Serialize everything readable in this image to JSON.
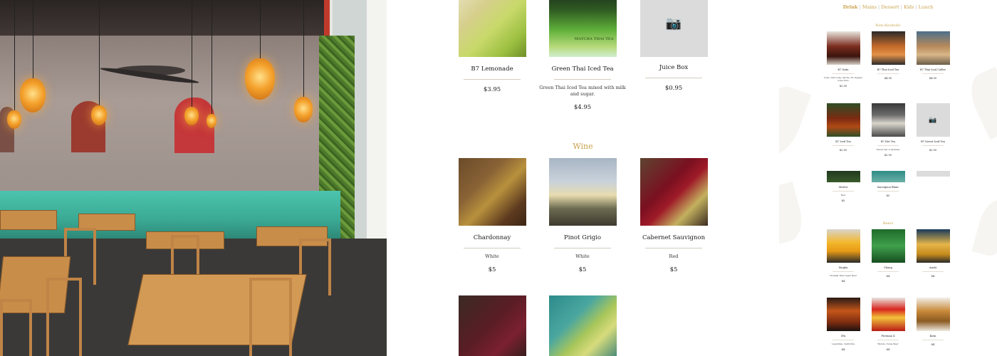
{
  "nav": {
    "items": [
      "Drink",
      "Mains",
      "Dessert",
      "Kids",
      "Lunch"
    ],
    "separator": "|"
  },
  "center": {
    "drinks": [
      {
        "name": "B7 Lemonade",
        "desc": "",
        "price": "$3.95"
      },
      {
        "name": "Green Thai Iced Tea",
        "desc": "Green Thai Iced Tea mixed with milk and sugar.",
        "price": "$4.95",
        "image_text": "MATCHA THAI TEA"
      },
      {
        "name": "Juice Box",
        "desc": "",
        "price": "$0.95"
      }
    ],
    "wine_title": "Wine",
    "wines": [
      {
        "name": "Chardonnay",
        "desc": "White",
        "price": "$5"
      },
      {
        "name": "Pinot Grigio",
        "desc": "White",
        "price": "$5"
      },
      {
        "name": "Cabernet Sauvignon",
        "desc": "Red",
        "price": "$5"
      }
    ]
  },
  "right": {
    "non_alcoholic_title": "Non-Alcoholic",
    "row1": [
      {
        "name": "B7 Soda",
        "desc": "Coke, Diet Coke, Sprite, Dr. Pepper, Coke Zero",
        "price": "$2.95"
      },
      {
        "name": "B7 Thai Iced Tea",
        "desc": "",
        "price": "$4.95"
      },
      {
        "name": "B7 Thai Iced Coffee",
        "desc": "",
        "price": "$4.95"
      }
    ],
    "row2": [
      {
        "name": "B7 Iced Tea",
        "desc": "",
        "price": "$2.95"
      },
      {
        "name": "B7 Hot Tea",
        "desc": "Green Tea or Jasmine",
        "price": "$2.95"
      },
      {
        "name": "B7 Sweet Iced Tea",
        "desc": "",
        "price": "$2.95"
      }
    ],
    "row3": [
      {
        "name": "Merlot",
        "desc": "Red",
        "price": "$5"
      },
      {
        "name": "Sauvignon Blanc",
        "desc": "",
        "price": "$5"
      }
    ],
    "beers_title": "Beers",
    "row4": [
      {
        "name": "Singha",
        "desc": "Original Thai Lager Beer",
        "price": "$4"
      },
      {
        "name": "Chang",
        "desc": "",
        "price": "$4"
      },
      {
        "name": "Asahi",
        "desc": "",
        "price": "$4"
      }
    ],
    "row5": [
      {
        "name": "IPA",
        "desc": "Lagunitas, California",
        "price": "$4"
      },
      {
        "name": "Fireman 4",
        "desc": "Blonde, Texas Beer",
        "price": "$4"
      },
      {
        "name": "Kirin",
        "desc": "",
        "price": "$4"
      }
    ]
  },
  "icons": {
    "placeholder": "camera-icon"
  },
  "colors": {
    "accent": "#c9a24a",
    "divider": "#d4cdbc",
    "placeholder": "#dbdbdb"
  }
}
